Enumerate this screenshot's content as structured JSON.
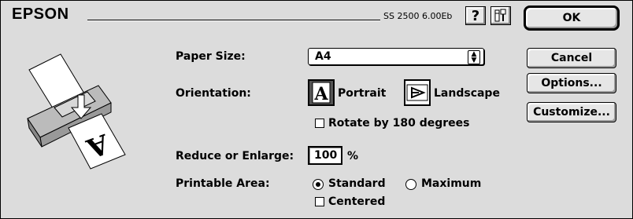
{
  "header": {
    "brand": "EPSON",
    "version": "SS 2500 6.00Eb"
  },
  "buttons": {
    "ok": "OK",
    "cancel": "Cancel",
    "options": "Options...",
    "customize": "Customize..."
  },
  "paper_size": {
    "label": "Paper Size:",
    "value": "A4"
  },
  "orientation": {
    "label": "Orientation:",
    "portrait": "Portrait",
    "landscape": "Landscape",
    "selected": "Portrait",
    "rotate_label": "Rotate by 180 degrees",
    "rotate_checked": false
  },
  "scale": {
    "label": "Reduce or Enlarge:",
    "value": "100",
    "unit": "%"
  },
  "printable_area": {
    "label": "Printable Area:",
    "standard": "Standard",
    "maximum": "Maximum",
    "selected": "Standard",
    "centered_label": "Centered",
    "centered_checked": false
  },
  "icons": {
    "help": "question-mark-icon",
    "tools": "tools-icon",
    "printer": "printer-illustration-icon"
  }
}
